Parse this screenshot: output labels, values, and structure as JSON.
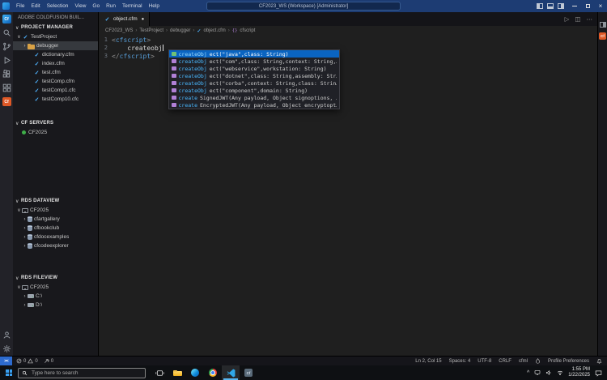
{
  "window": {
    "menus": [
      "File",
      "Edit",
      "Selection",
      "View",
      "Go",
      "Run",
      "Terminal",
      "Help"
    ],
    "title": "CF2023_WS (Workspace) [Administrator]"
  },
  "icons": {
    "chevron_down": "∨",
    "chevron_right": "›",
    "file_check": "✓",
    "modified_dot": "●",
    "breadcrumb_sep": "›",
    "close_window": "×",
    "run": "▷",
    "split_editor": "◫",
    "more_actions": "⋯",
    "remote": "><",
    "tray_caret": "^",
    "symbol_braces": "{}",
    "cf_badge": "Cf"
  },
  "activity_bar": {
    "top_icons": [
      "coldfusion-builder",
      "search",
      "source-control",
      "run-debug",
      "extensions",
      "dashboard",
      "coldfusion"
    ],
    "bottom_icons": [
      "account",
      "settings-gear"
    ]
  },
  "sidebar": {
    "app_title": "ADOBE COLDFUSION BUIL...",
    "sections": {
      "project": {
        "label": "PROJECT MANAGER"
      },
      "servers": {
        "label": "CF SERVERS"
      },
      "dataview": {
        "label": "RDS DATAVIEW"
      },
      "fileview": {
        "label": "RDS FILEVIEW"
      }
    },
    "project_tree": [
      {
        "label": "TestProject",
        "indent": 0,
        "expander": "expanded",
        "icon": "cfm"
      },
      {
        "label": "debugger",
        "indent": 1,
        "expander": "collapsed",
        "icon": "folder",
        "selected": true
      },
      {
        "label": "dictionary.cfm",
        "indent": 2,
        "icon": "cfm"
      },
      {
        "label": "index.cfm",
        "indent": 2,
        "icon": "cfm"
      },
      {
        "label": "test.cfm",
        "indent": 2,
        "icon": "cfm"
      },
      {
        "label": "testComp.cfm",
        "indent": 2,
        "icon": "cfm"
      },
      {
        "label": "testComp1.cfc",
        "indent": 2,
        "icon": "cfm"
      },
      {
        "label": "testComp10.cfc",
        "indent": 2,
        "icon": "cfm"
      }
    ],
    "servers_list": [
      {
        "label": "CF2025",
        "status": "running"
      }
    ],
    "dataview_tree": [
      {
        "label": "CF2025",
        "indent": 0,
        "expander": "expanded",
        "icon": "server"
      },
      {
        "label": "cfartgallery",
        "indent": 1,
        "expander": "collapsed",
        "icon": "database"
      },
      {
        "label": "cfbookclub",
        "indent": 1,
        "expander": "collapsed",
        "icon": "database"
      },
      {
        "label": "cfdocexamples",
        "indent": 1,
        "expander": "collapsed",
        "icon": "database"
      },
      {
        "label": "cfcodeexplorer",
        "indent": 1,
        "expander": "collapsed",
        "icon": "database"
      }
    ],
    "fileview_tree": [
      {
        "label": "CF2025",
        "indent": 0,
        "expander": "expanded",
        "icon": "server"
      },
      {
        "label": "C:\\",
        "indent": 1,
        "expander": "collapsed",
        "icon": "drive"
      },
      {
        "label": "D:\\",
        "indent": 1,
        "expander": "collapsed",
        "icon": "drive"
      }
    ]
  },
  "editor": {
    "tab": {
      "label": "object.cfm",
      "modified": true
    },
    "breadcrumb": [
      {
        "label": "CF2023_WS"
      },
      {
        "label": "TestProject"
      },
      {
        "label": "debugger"
      },
      {
        "label": "object.cfm",
        "icon": "cfm"
      },
      {
        "label": "cfscript",
        "icon": "symbol"
      }
    ],
    "code_lines": [
      {
        "num": "1",
        "segments": [
          {
            "text": "<",
            "cls": "punct"
          },
          {
            "text": "cfscript",
            "cls": "tag"
          },
          {
            "text": ">",
            "cls": "punct"
          }
        ]
      },
      {
        "num": "2",
        "segments": [
          {
            "text": "    createobj",
            "cls": "plain"
          }
        ],
        "cursor": true
      },
      {
        "num": "3",
        "segments": [
          {
            "text": "</",
            "cls": "punct"
          },
          {
            "text": "cfscript",
            "cls": "tag"
          },
          {
            "text": ">",
            "cls": "punct"
          }
        ]
      }
    ],
    "suggestions": [
      {
        "match": "createObj",
        "rest": "ect(\"java\",class: String)",
        "kind": "constructor",
        "selected": true
      },
      {
        "match": "createObj",
        "rest": "ect(\"com\",class: String,context: String,…",
        "kind": "method"
      },
      {
        "match": "createObj",
        "rest": "ect(\"webservice\",workstation: String)",
        "kind": "method"
      },
      {
        "match": "createObj",
        "rest": "ect(\"dotnet\",class: String,assembly: Str…",
        "kind": "method"
      },
      {
        "match": "createObj",
        "rest": "ect(\"corba\",context: String,class: Strin…",
        "kind": "method"
      },
      {
        "match": "createObj",
        "rest": "ect(\"component\",domain: String)",
        "kind": "method"
      },
      {
        "match": "create",
        "rest": "SignedJWT(Any payload, Object signoptions, …",
        "kind": "method"
      },
      {
        "match": "create",
        "rest": "EncryptedJWT(Any payload, Object encryptopt…",
        "kind": "method"
      }
    ]
  },
  "status_bar": {
    "errors": "0",
    "warnings": "0",
    "tasks": "0",
    "cursor_position": "Ln 2, Col 15",
    "indentation": "Spaces: 4",
    "encoding": "UTF-8",
    "eol": "CRLF",
    "language": "cfml",
    "profile": "Profile Preferences"
  },
  "taskbar": {
    "search_placeholder": "Type here to search",
    "clock": {
      "time": "1:55 PM",
      "date": "1/22/2025"
    }
  },
  "colors": {
    "titlebar": "#1d3c73",
    "suggest_selected": "#0a64c1",
    "cf_orange": "#de5826",
    "server_green": "#3fae49",
    "match_blue": "#49b8ff"
  }
}
